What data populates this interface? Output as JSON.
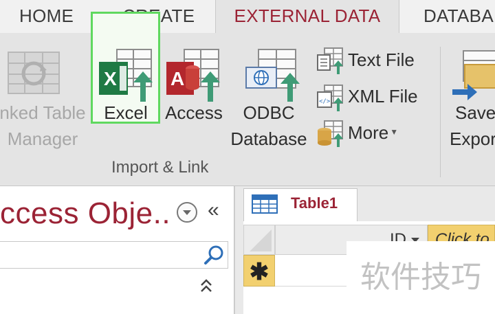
{
  "tabs": [
    "HOME",
    "CREATE",
    "EXTERNAL DATA",
    "DATABA"
  ],
  "active_tab": "EXTERNAL DATA",
  "ribbon": {
    "linked_table_manager": {
      "line1": "nked Table",
      "line2": "Manager",
      "disabled": true
    },
    "excel": {
      "label": "Excel",
      "highlighted": true
    },
    "access": {
      "label": "Access"
    },
    "odbc": {
      "line1": "ODBC",
      "line2": "Database"
    },
    "text_file": {
      "label": "Text File"
    },
    "xml_file": {
      "label": "XML File"
    },
    "more": {
      "label": "More"
    },
    "saved_exports": {
      "line1": "Save",
      "line2": "Expor"
    },
    "group_label": "Import & Link"
  },
  "nav_pane": {
    "title": "ccess Obje...",
    "collapse_glyph": "«",
    "scroll_glyph": "⌃"
  },
  "table": {
    "tab_label": "Table1",
    "columns": [
      "ID",
      "Click to"
    ],
    "new_row_marker": "✱"
  },
  "watermark": "软件技巧",
  "colors": {
    "accent": "#9b2335",
    "excel_green": "#1f7a44",
    "access_red": "#b3272d",
    "highlight_border": "#5fd85f",
    "new_record_yellow": "#f2d06f"
  }
}
